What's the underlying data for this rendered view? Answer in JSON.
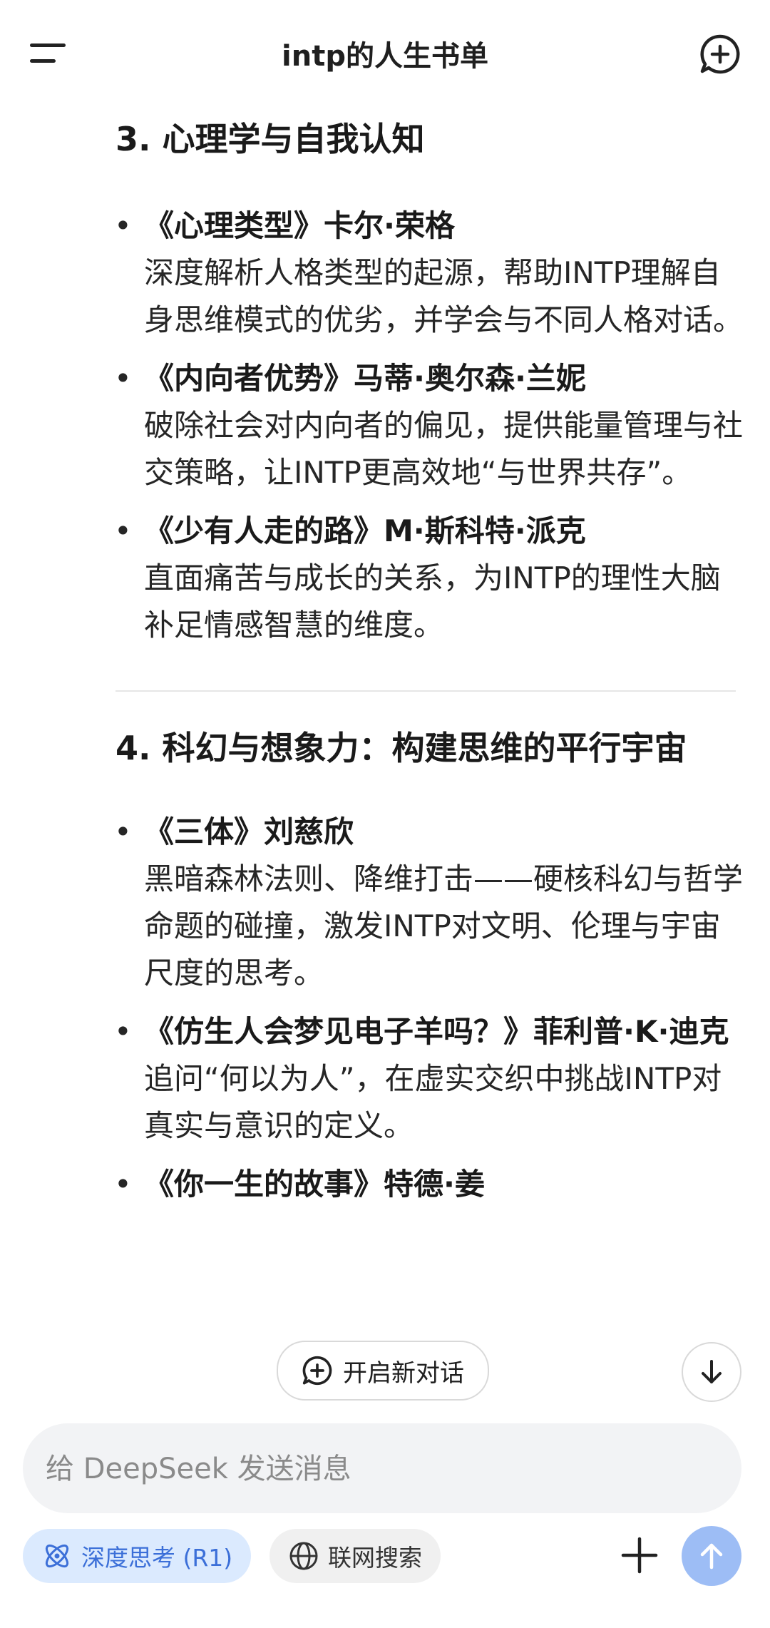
{
  "header": {
    "title": "intp的人生书单"
  },
  "sections": [
    {
      "heading": "3. 心理学与自我认知",
      "items": [
        {
          "book": "《心理类型》卡尔·荣格",
          "desc": "深度解析人格类型的起源，帮助INTP理解自身思维模式的优劣，并学会与不同人格对话。"
        },
        {
          "book": "《内向者优势》马蒂·奥尔森·兰妮",
          "desc": "破除社会对内向者的偏见，提供能量管理与社交策略，让INTP更高效地“与世界共存”。"
        },
        {
          "book": "《少有人走的路》M·斯科特·派克",
          "desc": "直面痛苦与成长的关系，为INTP的理性大脑补足情感智慧的维度。"
        }
      ]
    },
    {
      "heading": "4. 科幻与想象力：构建思维的平行宇宙",
      "items": [
        {
          "book": "《三体》刘慈欣",
          "desc": "黑暗森林法则、降维打击——硬核科幻与哲学命题的碰撞，激发INTP对文明、伦理与宇宙尺度的思考。"
        },
        {
          "book": "《仿生人会梦见电子羊吗？》菲利普·K·迪克",
          "desc": "追问“何以为人”，在虚实交织中挑战INTP对真实与意识的定义。"
        },
        {
          "book": "《你一生的故事》特德·姜",
          "desc": ""
        }
      ]
    }
  ],
  "overlay": {
    "new_chat_label": "开启新对话"
  },
  "composer": {
    "placeholder": "给 DeepSeek 发送消息"
  },
  "toolbar": {
    "deep_think_label": "深度思考 (R1)",
    "web_search_label": "联网搜索"
  },
  "colors": {
    "accent": "#3b6fd8",
    "chip_active_bg": "#dbeafe",
    "send_disabled": "#9dbdf5"
  },
  "icons": [
    "menu-icon",
    "new-chat-icon",
    "arrow-down-icon",
    "atom-icon",
    "globe-icon",
    "plus-icon",
    "arrow-up-icon"
  ]
}
